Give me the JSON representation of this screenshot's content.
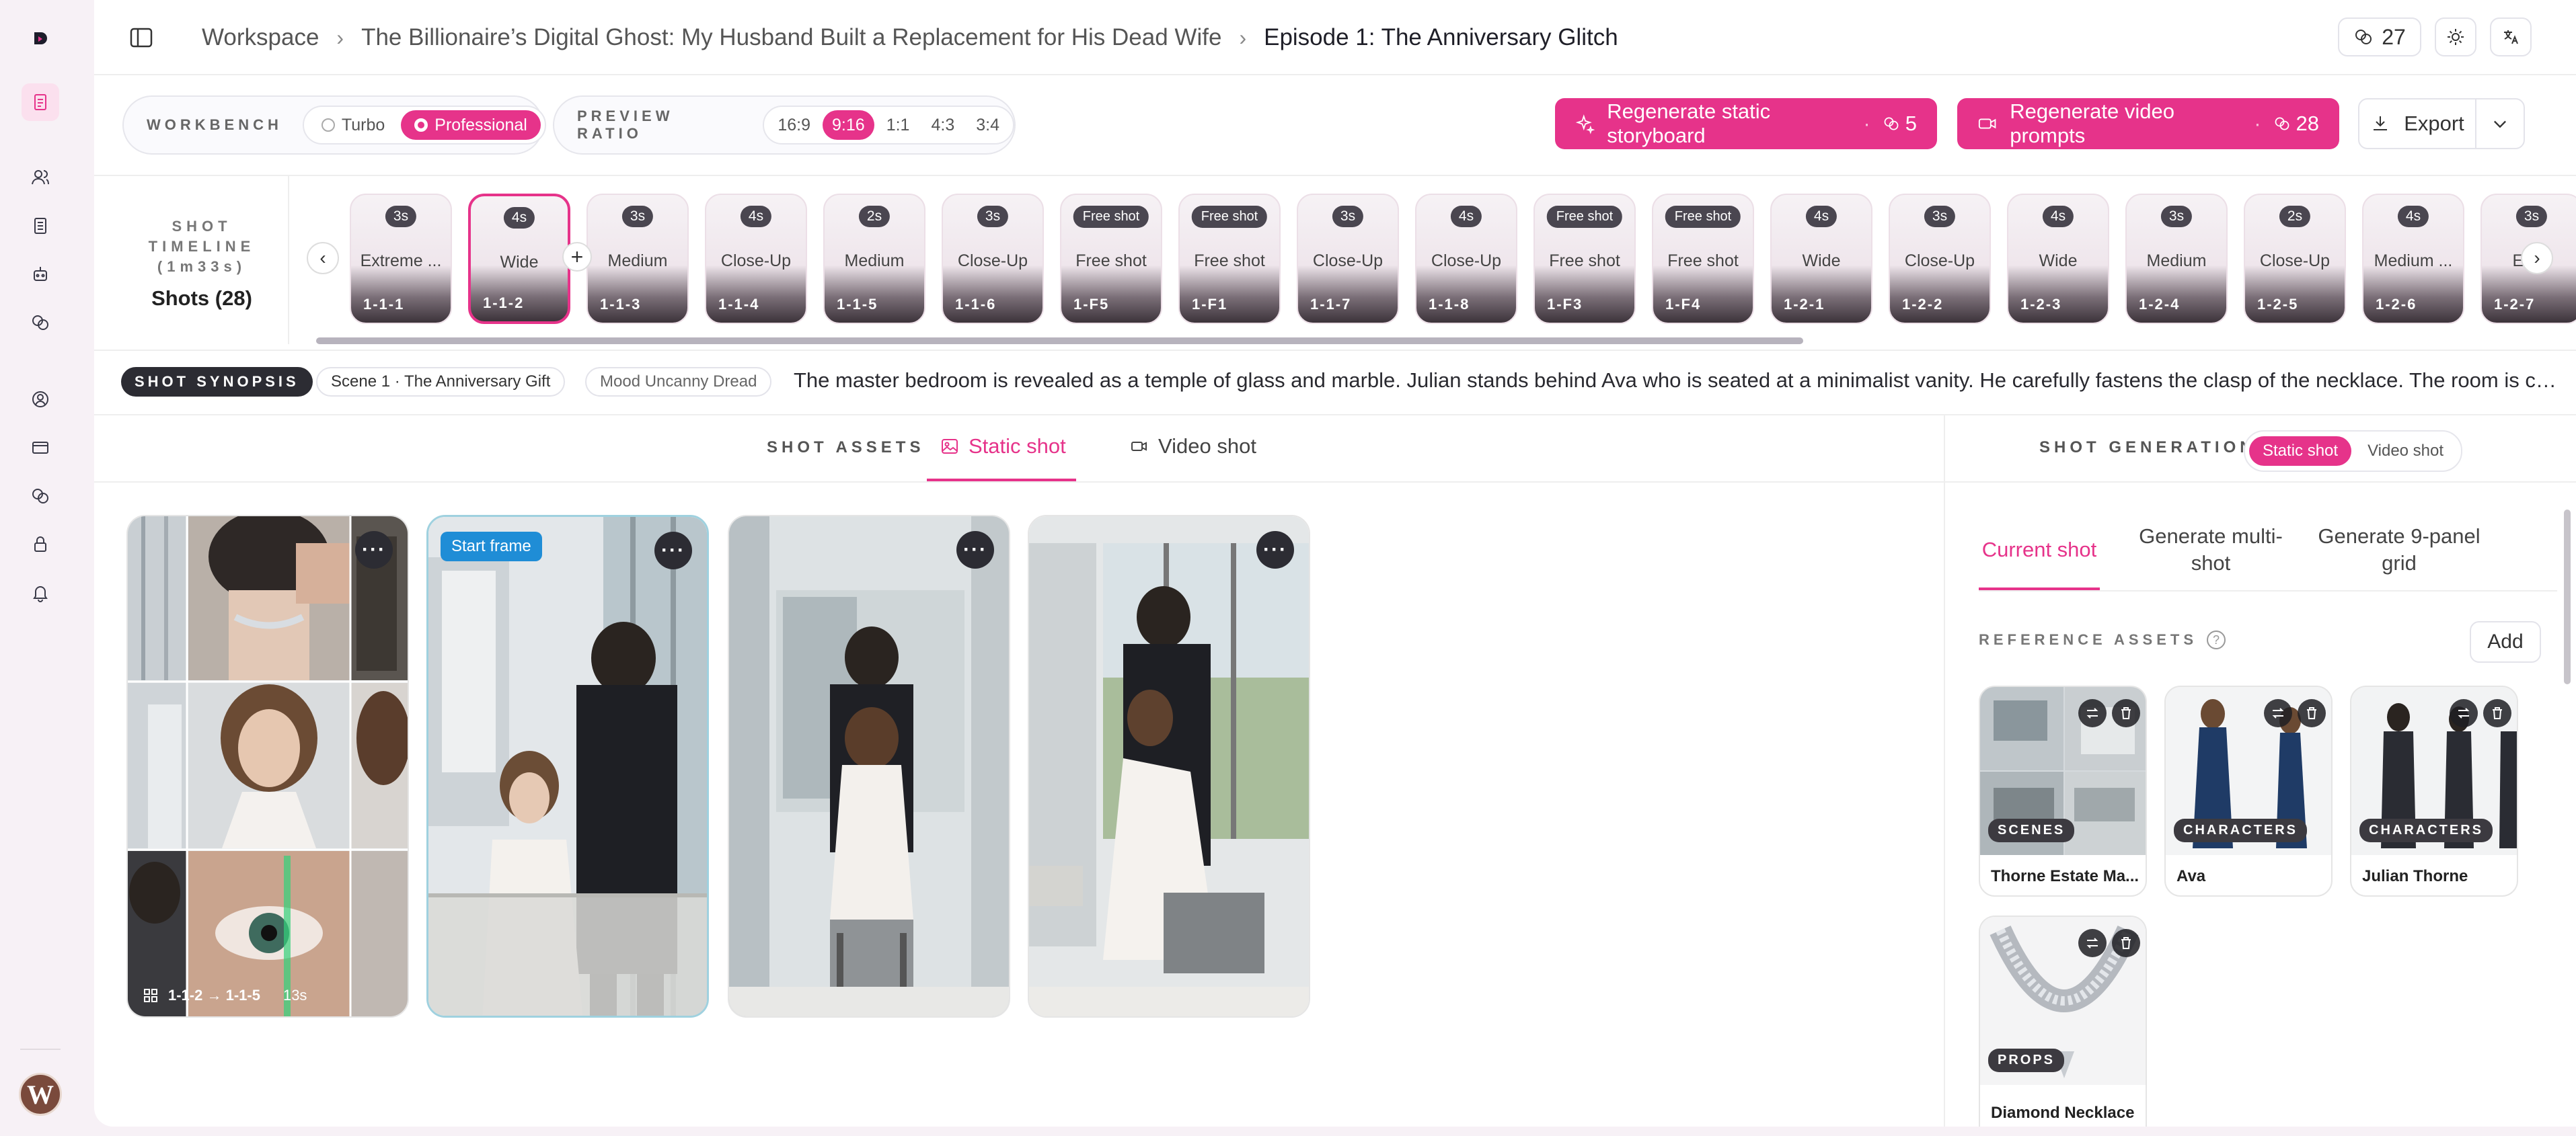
{
  "breadcrumb": {
    "workspace": "Workspace",
    "project": "The Billionaire’s Digital Ghost: My Husband Built a Replacement for His Dead Wife",
    "episode": "Episode 1: The Anniversary Glitch"
  },
  "header": {
    "credits": "27"
  },
  "workbench": {
    "label": "WORKBENCH",
    "modes": [
      "Turbo",
      "Professional"
    ],
    "active_mode": "Professional"
  },
  "preview_ratio": {
    "label": "PREVIEW RATIO",
    "options": [
      "16:9",
      "9:16",
      "1:1",
      "4:3",
      "3:4"
    ],
    "active": "9:16"
  },
  "actions": {
    "regen_storyboard": "Regenerate static storyboard",
    "regen_storyboard_count": "5",
    "regen_video": "Regenerate video prompts",
    "regen_video_count": "28",
    "export": "Export"
  },
  "timeline": {
    "label_line1": "SHOT",
    "label_line2": "TIMELINE",
    "label_line3": "(1m33s)",
    "shots_count": "Shots (28)",
    "shots": [
      {
        "dur": "3s",
        "label": "Extreme ...",
        "code": "1-1-1"
      },
      {
        "dur": "4s",
        "label": "Wide",
        "code": "1-1-2"
      },
      {
        "dur": "3s",
        "label": "Medium",
        "code": "1-1-3"
      },
      {
        "dur": "4s",
        "label": "Close-Up",
        "code": "1-1-4"
      },
      {
        "dur": "2s",
        "label": "Medium",
        "code": "1-1-5"
      },
      {
        "dur": "3s",
        "label": "Close-Up",
        "code": "1-1-6"
      },
      {
        "dur": "Free shot",
        "label": "Free shot",
        "code": "1-F5"
      },
      {
        "dur": "Free shot",
        "label": "Free shot",
        "code": "1-F1"
      },
      {
        "dur": "3s",
        "label": "Close-Up",
        "code": "1-1-7"
      },
      {
        "dur": "4s",
        "label": "Close-Up",
        "code": "1-1-8"
      },
      {
        "dur": "Free shot",
        "label": "Free shot",
        "code": "1-F3"
      },
      {
        "dur": "Free shot",
        "label": "Free shot",
        "code": "1-F4"
      },
      {
        "dur": "4s",
        "label": "Wide",
        "code": "1-2-1"
      },
      {
        "dur": "3s",
        "label": "Close-Up",
        "code": "1-2-2"
      },
      {
        "dur": "4s",
        "label": "Wide",
        "code": "1-2-3"
      },
      {
        "dur": "3s",
        "label": "Medium",
        "code": "1-2-4"
      },
      {
        "dur": "2s",
        "label": "Close-Up",
        "code": "1-2-5"
      },
      {
        "dur": "4s",
        "label": "Medium ...",
        "code": "1-2-6"
      },
      {
        "dur": "3s",
        "label": "Ext...",
        "code": "1-2-7"
      }
    ],
    "selected_index": 1,
    "scroll_fraction": 0.66
  },
  "synopsis": {
    "label": "SHOT SYNOPSIS",
    "scene": "Scene 1 · The Anniversary Gift",
    "mood": "Mood Uncanny Dread",
    "text": "The master bedroom is revealed as a temple of glass and marble. Julian stands behind Ava who is seated at a minimalist vanity. He carefully fastens the clasp of the necklace. The room is cold a..."
  },
  "shot_assets": {
    "label": "SHOT ASSETS",
    "tabs": [
      "Static shot",
      "Video shot"
    ],
    "active_tab": "Static shot",
    "grid_range": "1-1-2 → 1-1-5",
    "grid_duration": "13s",
    "start_frame_badge": "Start frame",
    "more": "···"
  },
  "shot_generation": {
    "label": "SHOT GENERATION",
    "toggle": [
      "Static shot",
      "Video shot"
    ],
    "active_toggle": "Static shot",
    "tabs": [
      "Current shot",
      "Generate multi-shot",
      "Generate 9-panel grid"
    ],
    "active_tab": "Current shot",
    "reference_label": "REFERENCE ASSETS",
    "add": "Add",
    "assets": [
      {
        "badge": "SCENES",
        "name": "Thorne Estate Ma..."
      },
      {
        "badge": "CHARACTERS",
        "name": "Ava"
      },
      {
        "badge": "CHARACTERS",
        "name": "Julian Thorne"
      },
      {
        "badge": "PROPS",
        "name": "Diamond Necklace"
      }
    ]
  },
  "colors": {
    "accent": "#e6338a",
    "dark": "#2c2c33"
  }
}
